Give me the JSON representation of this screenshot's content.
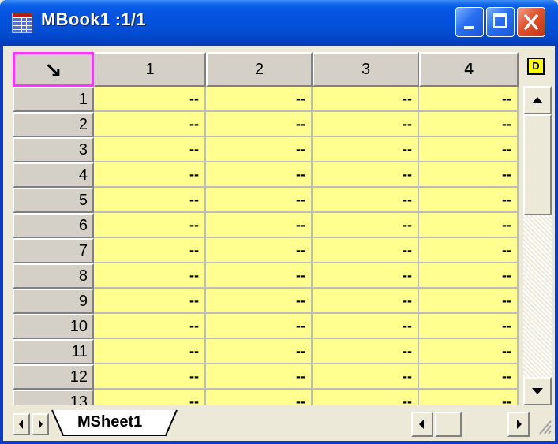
{
  "window": {
    "title": "MBook1 :1/1"
  },
  "grid": {
    "corner_glyph": "↘",
    "columns": [
      "1",
      "2",
      "3",
      "4"
    ],
    "rows": [
      "1",
      "2",
      "3",
      "4",
      "5",
      "6",
      "7",
      "8",
      "9",
      "10",
      "11",
      "12",
      "13"
    ],
    "empty_cell": "--"
  },
  "icons": {
    "app": "workbook-grid-icon",
    "minimize": "minimize-icon",
    "maximize": "maximize-icon",
    "close": "close-icon",
    "column_menu": "d-button-icon",
    "scroll_up": "arrow-up-icon",
    "scroll_down": "arrow-down-icon"
  },
  "colors": {
    "cell_fill": "#ffff8f",
    "corner_outline": "#ff33ff",
    "titlebar": "#0553e0",
    "close_button": "#e0532c"
  },
  "indicator_button": {
    "label": "D"
  },
  "sheets": {
    "tabs": [
      "MSheet1"
    ],
    "active": "MSheet1"
  }
}
